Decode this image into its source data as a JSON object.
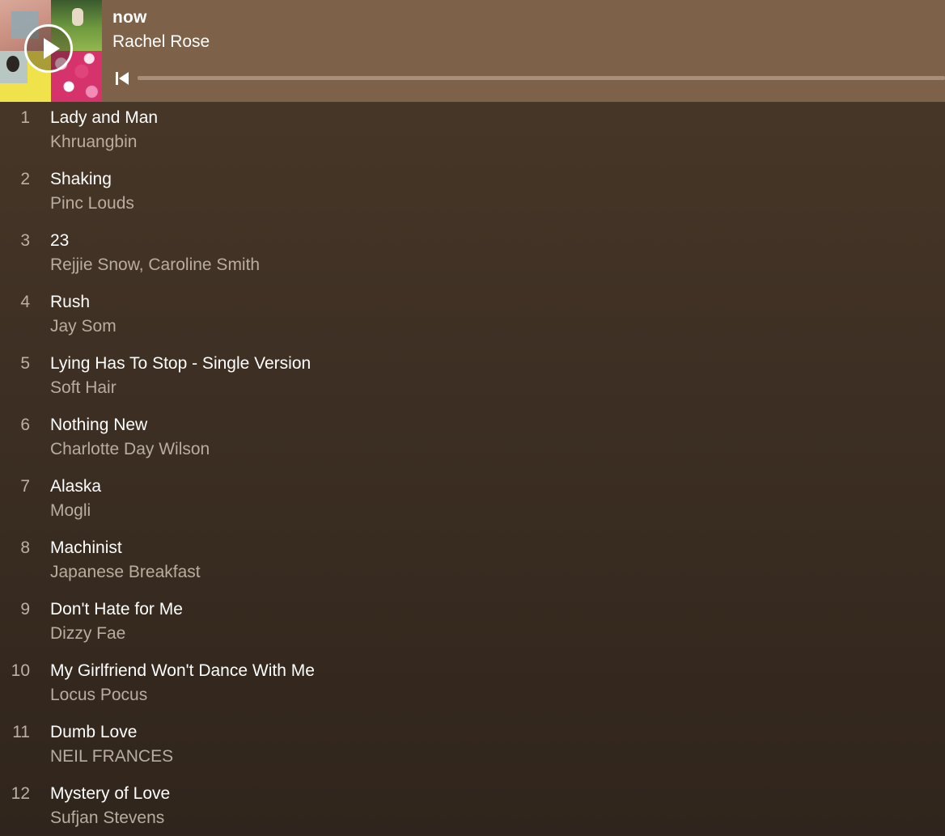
{
  "now_playing": {
    "playlist_title": "now",
    "artist": "Rachel Rose",
    "progress": 0.0
  },
  "icons": {
    "play": "play-icon",
    "previous": "skip-previous-icon"
  },
  "colors": {
    "header_bg": "#7d6148",
    "body_bg": "#3d2f23",
    "title_text": "#ffffff",
    "secondary_text": "#b9ad9f"
  },
  "tracks": [
    {
      "number": "1",
      "title": "Lady and Man",
      "artist": "Khruangbin"
    },
    {
      "number": "2",
      "title": "Shaking",
      "artist": "Pinc Louds"
    },
    {
      "number": "3",
      "title": "23",
      "artist": "Rejjie Snow, Caroline Smith"
    },
    {
      "number": "4",
      "title": "Rush",
      "artist": "Jay Som"
    },
    {
      "number": "5",
      "title": "Lying Has To Stop - Single Version",
      "artist": "Soft Hair"
    },
    {
      "number": "6",
      "title": "Nothing New",
      "artist": "Charlotte Day Wilson"
    },
    {
      "number": "7",
      "title": "Alaska",
      "artist": "Mogli"
    },
    {
      "number": "8",
      "title": "Machinist",
      "artist": "Japanese Breakfast"
    },
    {
      "number": "9",
      "title": "Don't Hate for Me",
      "artist": "Dizzy Fae"
    },
    {
      "number": "10",
      "title": "My Girlfriend Won't Dance With Me",
      "artist": "Locus Pocus"
    },
    {
      "number": "11",
      "title": "Dumb Love",
      "artist": "NEIL FRANCES"
    },
    {
      "number": "12",
      "title": "Mystery of Love",
      "artist": "Sufjan Stevens"
    }
  ]
}
